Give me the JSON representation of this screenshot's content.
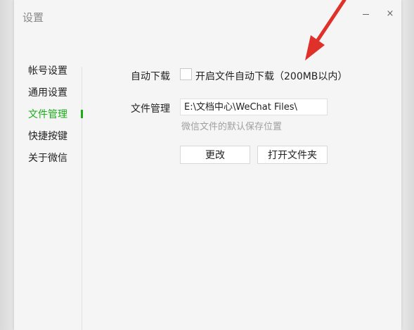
{
  "window": {
    "title": "设置",
    "minimize_label": "",
    "close_label": "×"
  },
  "sidebar": {
    "items": [
      {
        "label": "帐号设置"
      },
      {
        "label": "通用设置"
      },
      {
        "label": "文件管理"
      },
      {
        "label": "快捷按键"
      },
      {
        "label": "关于微信"
      }
    ],
    "active_index": 2,
    "active_color": "#1aad19"
  },
  "file_manage": {
    "auto_download_label": "自动下载",
    "auto_download_checked": false,
    "auto_download_option": "开启文件自动下载（200MB以内）",
    "file_manage_label": "文件管理",
    "path_value": "E:\\文档中心\\WeChat Files\\",
    "path_hint": "微信文件的默认保存位置",
    "change_button": "更改",
    "open_folder_button": "打开文件夹"
  },
  "annotation": {
    "arrow_color": "#e0302a"
  }
}
